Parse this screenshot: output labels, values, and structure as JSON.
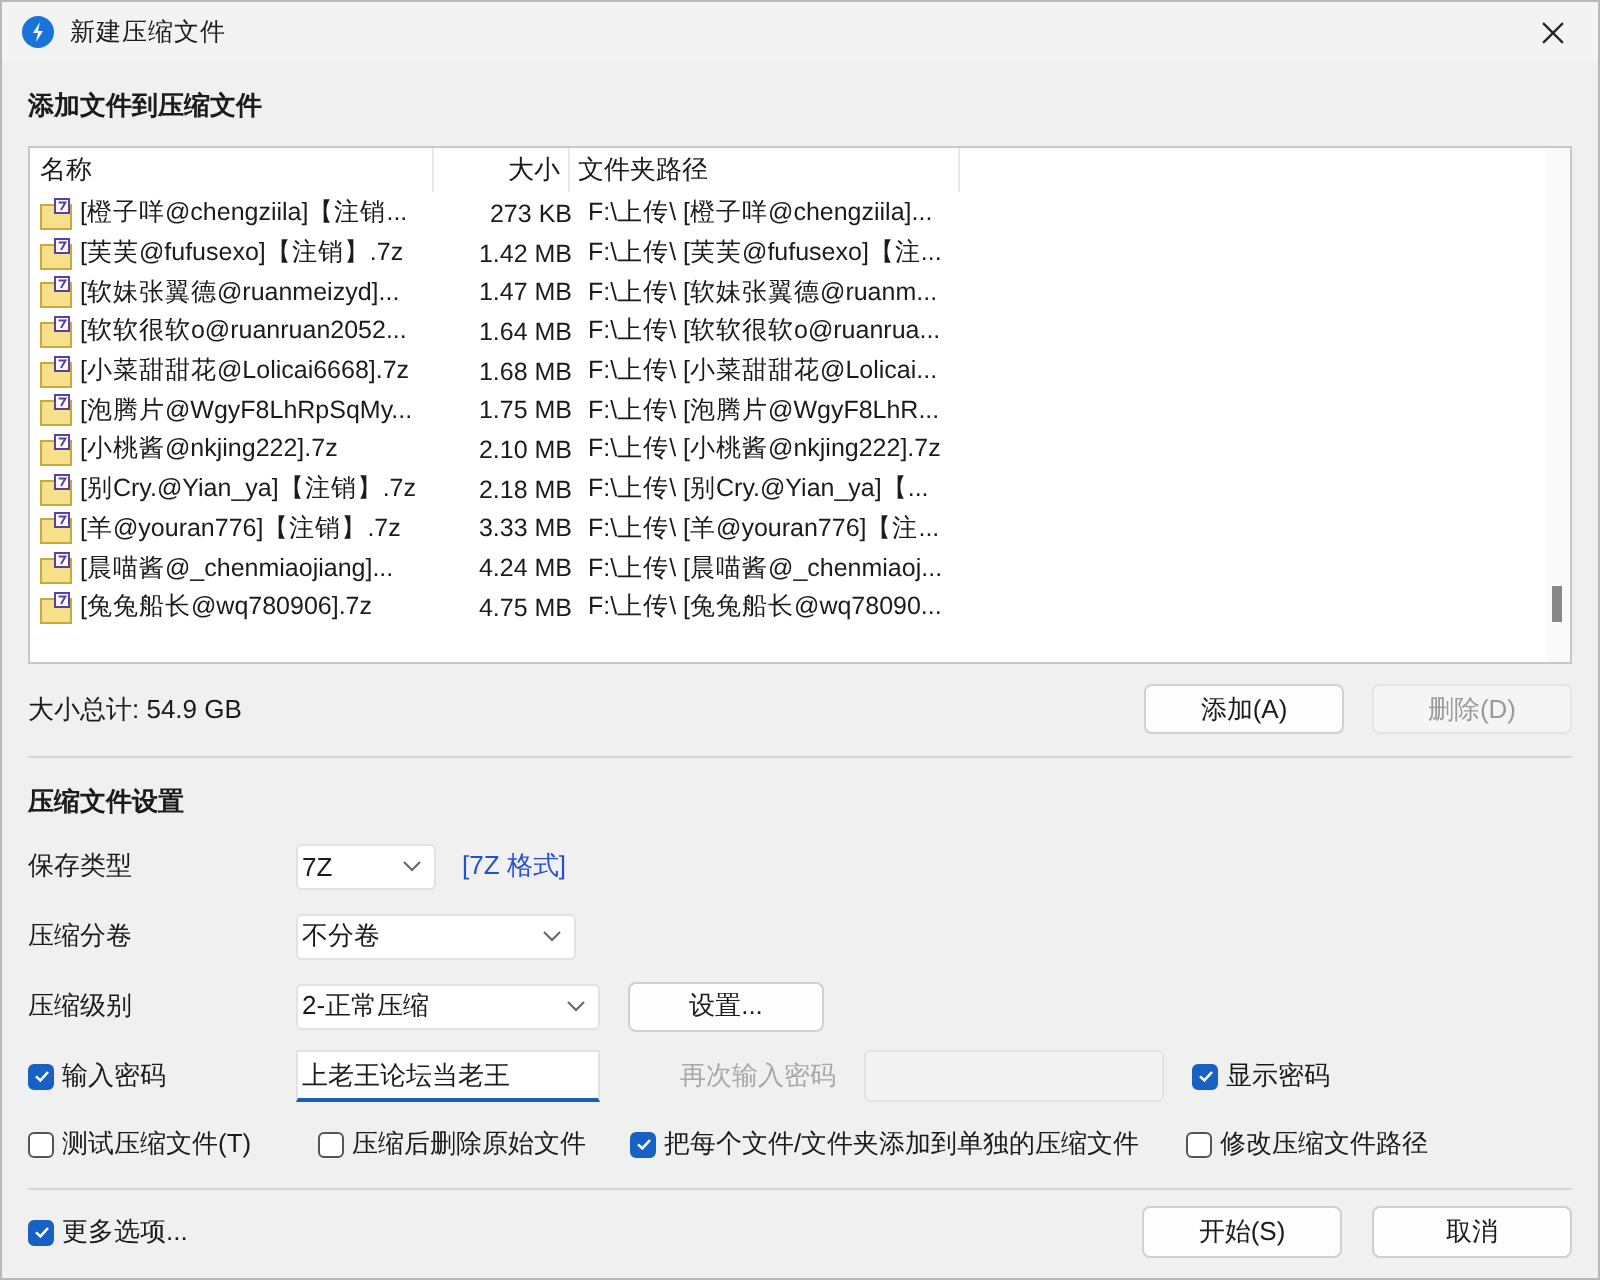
{
  "window": {
    "title": "新建压缩文件"
  },
  "add_section": {
    "heading": "添加文件到压缩文件"
  },
  "file_list": {
    "columns": [
      "名称",
      "大小",
      "文件夹路径"
    ],
    "rows": [
      {
        "name": "[橙子咩@chengziila]【注销...",
        "size": "273 KB",
        "path": "F:\\上传\\ [橙子咩@chengziila]..."
      },
      {
        "name": "[芙芙@fufusexo]【注销】.7z",
        "size": "1.42 MB",
        "path": "F:\\上传\\ [芙芙@fufusexo]【注..."
      },
      {
        "name": "[软妹张翼德@ruanmeizyd]...",
        "size": "1.47 MB",
        "path": "F:\\上传\\ [软妹张翼德@ruanm..."
      },
      {
        "name": "[软软很软o@ruanruan2052...",
        "size": "1.64 MB",
        "path": "F:\\上传\\ [软软很软o@ruanrua..."
      },
      {
        "name": "[小菜甜甜花@Lolicai6668].7z",
        "size": "1.68 MB",
        "path": "F:\\上传\\ [小菜甜甜花@Lolicai..."
      },
      {
        "name": "[泡腾片@WgyF8LhRpSqMy...",
        "size": "1.75 MB",
        "path": "F:\\上传\\ [泡腾片@WgyF8LhR..."
      },
      {
        "name": "[小桃酱@nkjing222].7z",
        "size": "2.10 MB",
        "path": "F:\\上传\\ [小桃酱@nkjing222].7z"
      },
      {
        "name": "[别Cry.@Yian_ya]【注销】.7z",
        "size": "2.18 MB",
        "path": "F:\\上传\\ [别Cry.@Yian_ya]【..."
      },
      {
        "name": "[羊@youran776]【注销】.7z",
        "size": "3.33 MB",
        "path": "F:\\上传\\ [羊@youran776]【注..."
      },
      {
        "name": "[晨喵酱@_chenmiaojiang]...",
        "size": "4.24 MB",
        "path": "F:\\上传\\ [晨喵酱@_chenmiaoj..."
      },
      {
        "name": "[兔兔船长@wq780906].7z",
        "size": "4.75 MB",
        "path": "F:\\上传\\ [兔兔船长@wq78090..."
      }
    ]
  },
  "total": "大小总计: 54.9 GB",
  "list_buttons": [
    {
      "label": "添加(A)",
      "disabled": false
    },
    {
      "label": "删除(D)",
      "disabled": true
    }
  ],
  "settings": {
    "heading": "压缩文件设置",
    "format": {
      "label": "保存类型",
      "value": "7Z",
      "link": "[7Z 格式]"
    },
    "split": {
      "label": "压缩分卷",
      "value": "不分卷"
    },
    "level": {
      "label": "压缩级别",
      "value": "2-正常压缩",
      "button": "设置..."
    },
    "password": {
      "label": "输入密码",
      "checked": true,
      "value": "上老王论坛当老王"
    },
    "confirm": {
      "label": "再次输入密码",
      "disabled": true
    },
    "show_password": {
      "label": "显示密码",
      "checked": true
    },
    "options": [
      {
        "label": "测试压缩文件(T)",
        "checked": false
      },
      {
        "label": "压缩后删除原始文件",
        "checked": false
      },
      {
        "label": "把每个文件/文件夹添加到单独的压缩文件",
        "checked": true
      },
      {
        "label": "修改压缩文件路径",
        "checked": false
      }
    ]
  },
  "more_options": {
    "label": "更多选项...",
    "checked": true
  },
  "buttons": [
    {
      "label": "开始(S)"
    },
    {
      "label": "取消"
    }
  ]
}
